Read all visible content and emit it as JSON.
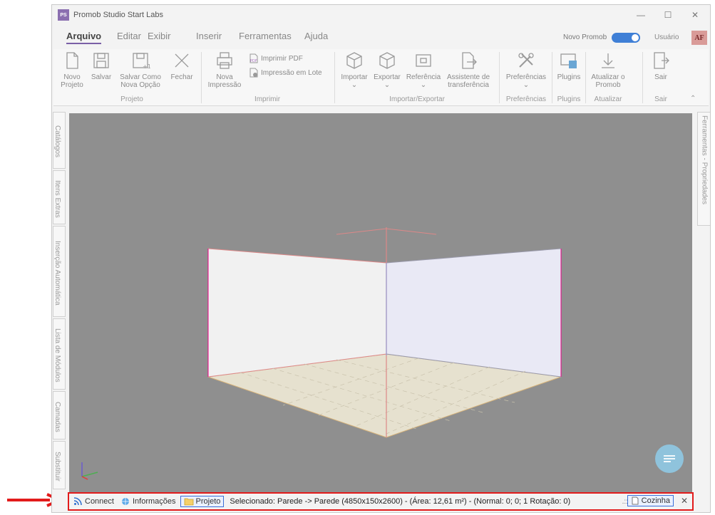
{
  "window": {
    "title": "Promob Studio Start Labs",
    "logo_text": "PS",
    "controls": {
      "minimize": "—",
      "maximize": "☐",
      "close": "✕"
    }
  },
  "menu": {
    "items": [
      "Arquivo",
      "Editar",
      "Exibir",
      "Inserir",
      "Ferramentas",
      "Ajuda"
    ],
    "active": "Arquivo",
    "toggle_label": "Novo Promob",
    "toggle_on": true,
    "user_label": "Usuário",
    "avatar_text": "AF"
  },
  "ribbon": {
    "groups": {
      "projeto": "Projeto",
      "imprimir": "Imprimir",
      "importar_exportar": "Importar/Exportar",
      "preferencias": "Preferências",
      "plugins": "Plugins",
      "atualizar": "Atualizar",
      "sair": "Sair"
    },
    "buttons": {
      "novo_projeto": "Novo\nProjeto",
      "salvar": "Salvar",
      "salvar_como": "Salvar Como\nNova Opção",
      "fechar": "Fechar",
      "nova_impressao": "Nova\nImpressão",
      "imprimir_pdf": "Imprimir PDF",
      "impressao_lote": "Impressão em Lote",
      "importar": "Importar",
      "exportar": "Exportar",
      "referencia": "Referência",
      "assistente": "Assistente de\ntransferência",
      "preferencias": "Preferências",
      "plugins": "Plugins",
      "atualizar": "Atualizar o\nPromob",
      "sair": "Sair"
    }
  },
  "left_panel": {
    "tabs": [
      "Catálogos",
      "Itens Extras",
      "Inserção Automática",
      "Lista de Módulos",
      "Camadas",
      "Substituir"
    ]
  },
  "right_panel": {
    "tab": "Ferramentas - Propriedades"
  },
  "statusbar": {
    "connect": "Connect",
    "informacoes": "Informações",
    "projeto": "Projeto",
    "status_text": "Selecionado: Parede -> Parede (4850x150x2600) - (Área: 12,61 m²) - (Normal: 0; 0; 1 Rotação: 0)",
    "environment": "Cozinha",
    "close": "✕",
    "grip": ".::"
  },
  "colors": {
    "accent": "#7a5fa6",
    "toggle": "#3f7fd6",
    "viewport_bg": "#8f8f8f",
    "highlight_red": "#e21b1b"
  }
}
